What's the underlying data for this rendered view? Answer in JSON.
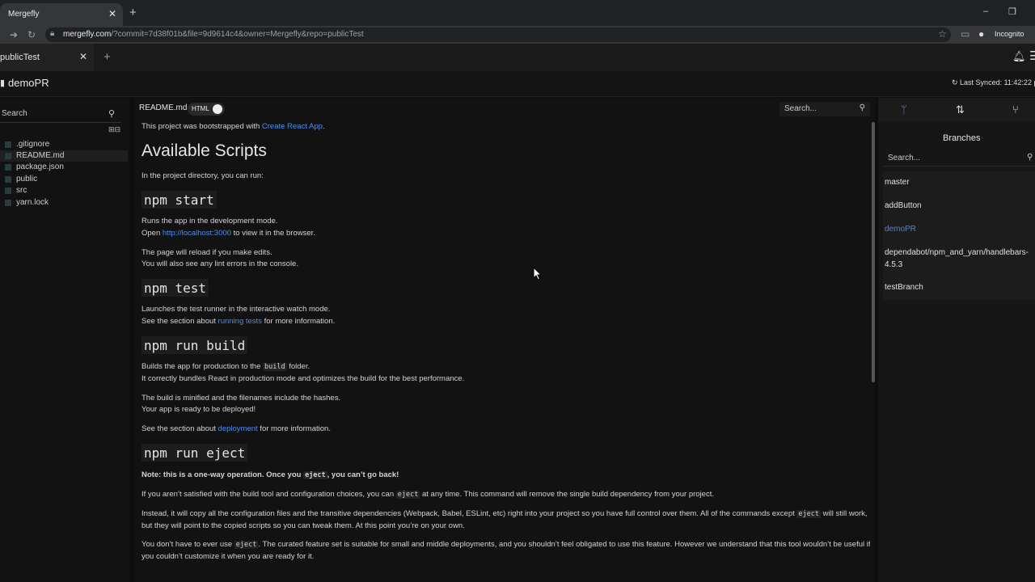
{
  "browser": {
    "tab_title": "Mergefly",
    "tab_close": "✕",
    "new_tab": "+",
    "url_host": "mergefly.com",
    "url_rest": "/?commit=7d38f01b&file=9d9614c4&owner=Mergefly&repo=publicTest",
    "incognito_label": "Incognito",
    "minimize": "–",
    "restore": "❐"
  },
  "app": {
    "tab_title": "publicTest",
    "tab_close": "✕",
    "add_tab": "+",
    "repo_name": "demoPR",
    "last_synced": "Last Synced: 11:42:22 p"
  },
  "sidebar": {
    "search_placeholder": "Search",
    "files": [
      {
        "name": ".gitignore"
      },
      {
        "name": "README.md"
      },
      {
        "name": "package.json"
      },
      {
        "name": "public"
      },
      {
        "name": "src"
      },
      {
        "name": "yarn.lock"
      }
    ]
  },
  "editor": {
    "file_tab": "README.md",
    "html_toggle_label": "HTML",
    "html_toggle_on": true,
    "search_placeholder": "Search..."
  },
  "readme": {
    "intro_pre": "This project was bootstrapped with ",
    "intro_link": "Create React App",
    "intro_post": ".",
    "h_available": "Available Scripts",
    "p_run": "In the project directory, you can run:",
    "h_start": "npm start",
    "start_1": "Runs the app in the development mode.",
    "start_2_pre": "Open ",
    "start_2_link": "http://localhost:3000",
    "start_2_post": " to view it in the browser.",
    "start_3": "The page will reload if you make edits.",
    "start_4": "You will also see any lint errors in the console.",
    "h_test": "npm test",
    "test_1": "Launches the test runner in the interactive watch mode.",
    "test_2_pre": "See the section about ",
    "test_2_link": "running tests",
    "test_2_post": " for more information.",
    "h_build": "npm run build",
    "build_1_pre": "Builds the app for production to the ",
    "build_1_code": "build",
    "build_1_post": " folder.",
    "build_2": "It correctly bundles React in production mode and optimizes the build for the best performance.",
    "build_3": "The build is minified and the filenames include the hashes.",
    "build_4": "Your app is ready to be deployed!",
    "build_5_pre": "See the section about ",
    "build_5_link": "deployment",
    "build_5_post": " for more information.",
    "h_eject": "npm run eject",
    "eject_note_pre": "Note: this is a one-way operation. Once you ",
    "eject_note_code": "eject",
    "eject_note_post": ", you can’t go back!",
    "eject_1_pre": "If you aren’t satisfied with the build tool and configuration choices, you can ",
    "eject_1_code": "eject",
    "eject_1_post": " at any time. This command will remove the single build dependency from your project.",
    "eject_2_pre": "Instead, it will copy all the configuration files and the transitive dependencies (Webpack, Babel, ESLint, etc) right into your project so you have full control over them. All of the commands except ",
    "eject_2_code": "eject",
    "eject_2_post": " will still work, but they will point to the copied scripts so you can tweak them. At this point you’re on your own.",
    "eject_3_pre": "You don’t have to ever use ",
    "eject_3_code": "eject",
    "eject_3_post": ". The curated feature set is suitable for small and middle deployments, and you shouldn’t feel obligated to use this feature. However we understand that this tool wouldn’t be useful if you couldn’t customize it when you are ready for it."
  },
  "branches": {
    "title": "Branches",
    "search_placeholder": "Search...",
    "active": "demoPR",
    "items": [
      {
        "name": "master"
      },
      {
        "name": "addButton"
      },
      {
        "name": "demoPR"
      },
      {
        "name": "dependabot/npm_and_yarn/handlebars-4.5.3"
      },
      {
        "name": "testBranch"
      }
    ]
  },
  "colors": {
    "link": "#4c8df0",
    "active_branch": "#5d84b8",
    "background": "#121212"
  }
}
